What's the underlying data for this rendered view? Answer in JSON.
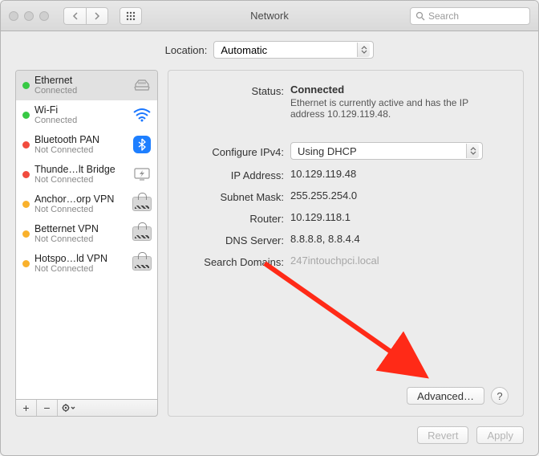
{
  "window": {
    "title": "Network",
    "search_placeholder": "Search"
  },
  "location": {
    "label": "Location:",
    "value": "Automatic"
  },
  "sidebar": {
    "items": [
      {
        "name": "Ethernet",
        "sub": "Connected",
        "status": "green",
        "icon": "ethernet",
        "selected": true
      },
      {
        "name": "Wi-Fi",
        "sub": "Connected",
        "status": "green",
        "icon": "wifi",
        "selected": false
      },
      {
        "name": "Bluetooth PAN",
        "sub": "Not Connected",
        "status": "red",
        "icon": "bluetooth",
        "selected": false
      },
      {
        "name": "Thunde…lt Bridge",
        "sub": "Not Connected",
        "status": "red",
        "icon": "thunderbolt",
        "selected": false
      },
      {
        "name": "Anchor…orp VPN",
        "sub": "Not Connected",
        "status": "orange",
        "icon": "vpn",
        "selected": false
      },
      {
        "name": "Betternet VPN",
        "sub": "Not Connected",
        "status": "orange",
        "icon": "vpn",
        "selected": false
      },
      {
        "name": "Hotspo…ld VPN",
        "sub": "Not Connected",
        "status": "orange",
        "icon": "vpn",
        "selected": false
      }
    ],
    "tools": {
      "add": "+",
      "remove": "−",
      "gear": "⚙"
    }
  },
  "detail": {
    "status_label": "Status:",
    "status_value": "Connected",
    "status_desc": "Ethernet is currently active and has the IP address 10.129.119.48.",
    "config_label": "Configure IPv4:",
    "config_value": "Using DHCP",
    "ip_label": "IP Address:",
    "ip_value": "10.129.119.48",
    "subnet_label": "Subnet Mask:",
    "subnet_value": "255.255.254.0",
    "router_label": "Router:",
    "router_value": "10.129.118.1",
    "dns_label": "DNS Server:",
    "dns_value": "8.8.8.8, 8.8.4.4",
    "search_label": "Search Domains:",
    "search_value": "247intouchpci.local",
    "advanced_label": "Advanced…",
    "help_label": "?"
  },
  "footer": {
    "revert": "Revert",
    "apply": "Apply"
  },
  "annotation": {
    "arrow_color": "#ff2a17"
  }
}
